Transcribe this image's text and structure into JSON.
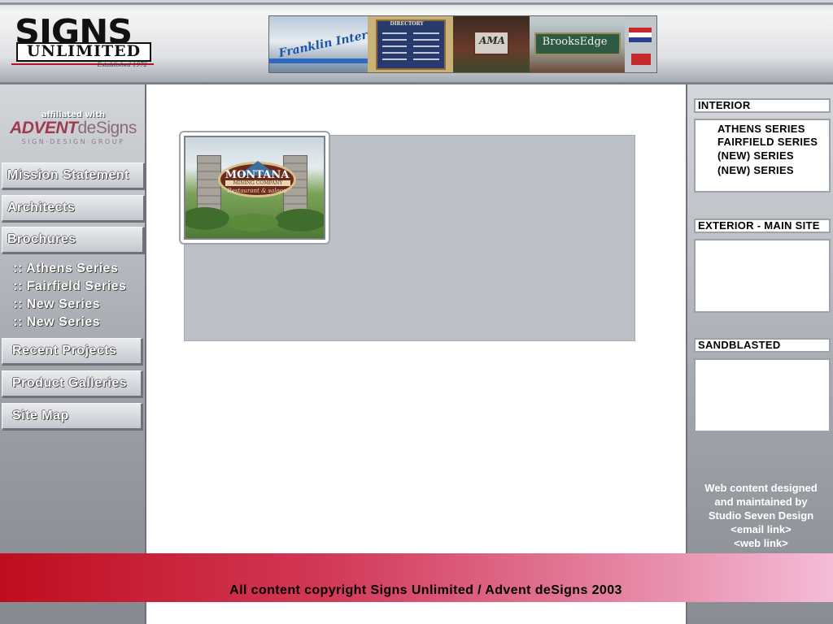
{
  "header": {
    "logo": {
      "line1": "SIGNS",
      "line2": "UNLIMITED",
      "established": "Established 1972"
    },
    "photo_strip": {
      "photo1_caption": "Franklin International",
      "photo2_caption": "DIRECTORY",
      "photo3_caption": "AMA",
      "photo4_caption": "BrooksEdge"
    }
  },
  "sidebar_left": {
    "affiliate": {
      "prefix": "affiliated with",
      "brand_bold": "ADVENT",
      "brand_rest": "deSigns",
      "tagline": "SIGN·DESIGN·GROUP"
    },
    "nav": {
      "mission": "Mission Statement",
      "architects": "Architects",
      "brochures": "Brochures",
      "recent_projects": "Recent Projects",
      "product_galleries": "Product Galleries",
      "site_map": "Site Map"
    },
    "brochure_sub": [
      ":: Athens Series",
      ":: Fairfield Series",
      ":: New Series",
      ":: New Series"
    ]
  },
  "main": {
    "featured": {
      "sign_title": "MONTANA",
      "sign_subtitle": "MINING COMPANY",
      "sign_tagline": "Restaurant & saloon"
    }
  },
  "sidebar_right": {
    "interior": {
      "title": "INTERIOR",
      "items": [
        "ATHENS SERIES",
        "FAIRFIELD SERIES",
        "(NEW) SERIES",
        "(NEW) SERIES"
      ]
    },
    "exterior": {
      "title": "EXTERIOR - MAIN SITE"
    },
    "sandblasted": {
      "title": "SANDBLASTED"
    },
    "credits": {
      "line1": "Web content designed",
      "line2": "and maintained by",
      "line3": "Studio Seven Design",
      "email_link": "<email link>",
      "web_link": "<web link>"
    }
  },
  "footer": {
    "copyright": "All content copyright Signs Unlimited / Advent deSigns 2003"
  },
  "colors": {
    "footer_start": "#c00d1e",
    "footer_end": "#f4bcd8",
    "brand_red": "#b8102d",
    "panel_gray": "#bcc1c8"
  }
}
